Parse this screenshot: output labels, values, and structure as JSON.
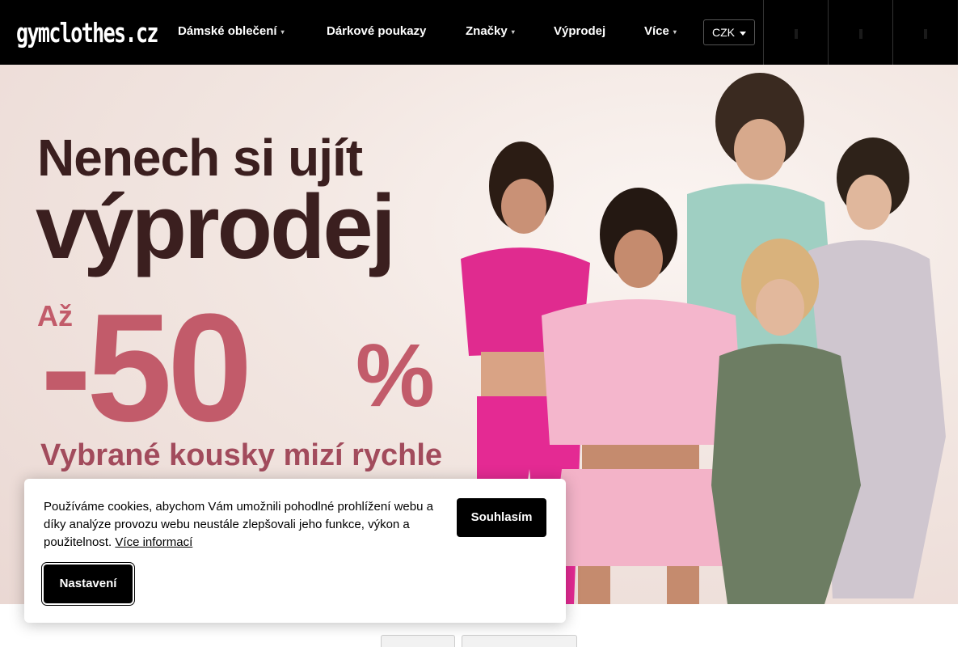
{
  "header": {
    "logo_text": "gymclothes.cz",
    "nav": [
      {
        "label": "Dámské oblečení",
        "has_dropdown": true
      },
      {
        "label": "Dárkové poukazy",
        "has_dropdown": false
      },
      {
        "label": "Značky",
        "has_dropdown": true
      },
      {
        "label": "Výprodej",
        "has_dropdown": false
      },
      {
        "label": "Více",
        "has_dropdown": true
      }
    ],
    "currency": "CZK",
    "icons": [
      "search-icon",
      "user-icon",
      "cart-icon"
    ],
    "colors": {
      "background": "#000000",
      "text": "#ffffff"
    }
  },
  "hero": {
    "line1": "Nenech si ujít",
    "line2": "výprodej",
    "prefix": "Až",
    "discount": "-50",
    "percent": "%",
    "subtitle": "Vybrané kousky mizí rychle",
    "colors": {
      "dark": "#3b1f1f",
      "accent": "#c25b6a"
    }
  },
  "cookie": {
    "text": "Používáme cookies, abychom Vám umožnili pohodlné prohlížení webu a díky analýze provozu webu neustále zlepšovali jeho funkce, výkon a použitelnost.",
    "link": "Více informací",
    "accept_label": "Souhlasím",
    "settings_label": "Nastavení"
  }
}
